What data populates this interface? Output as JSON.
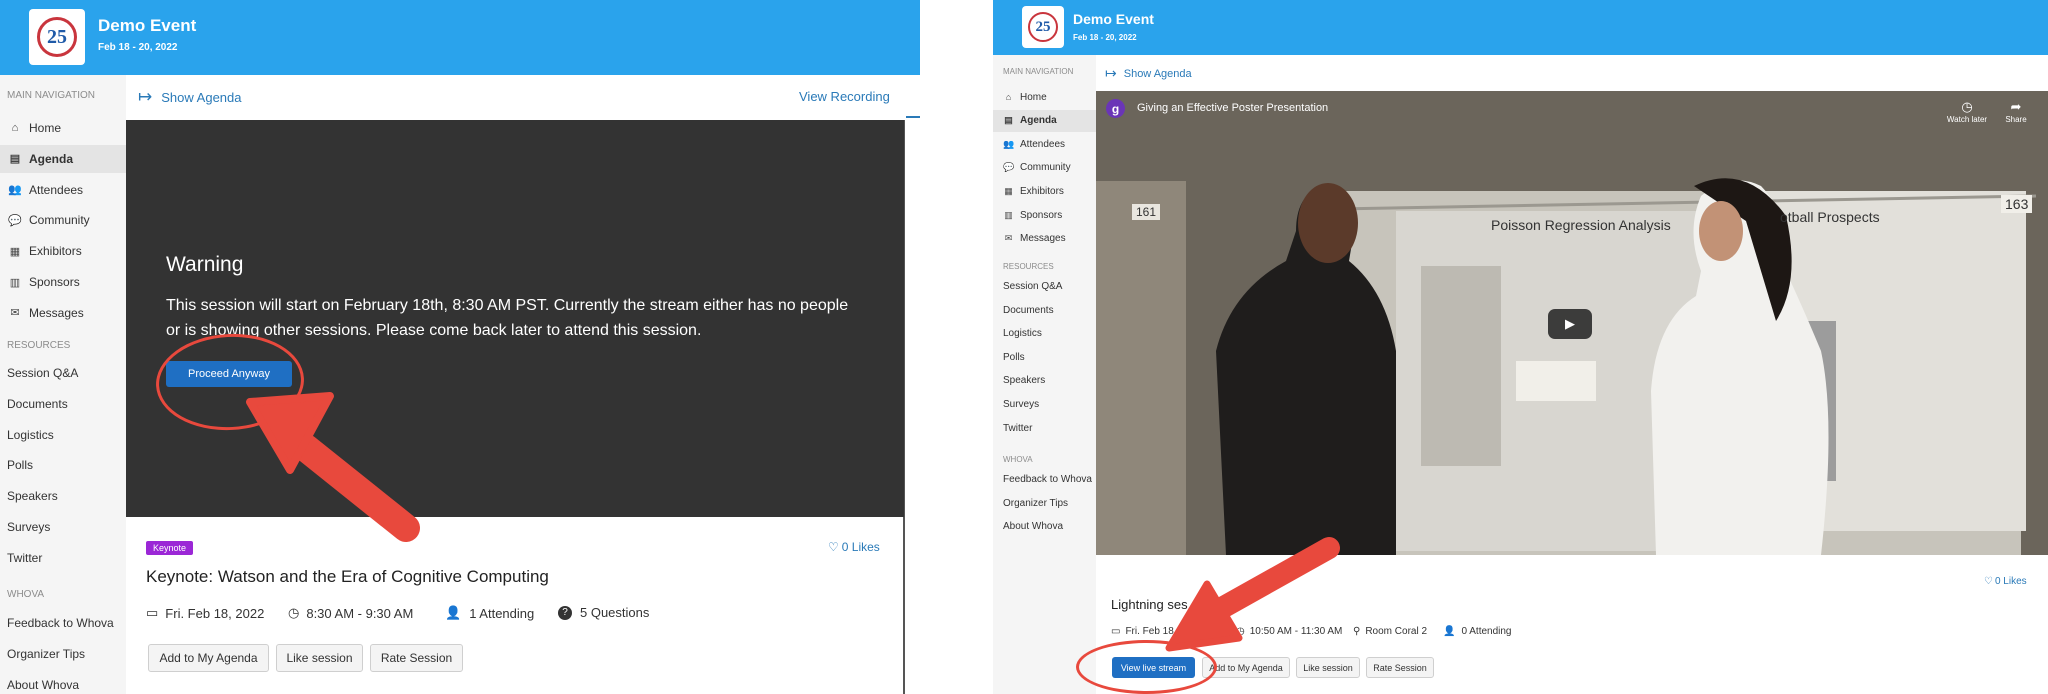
{
  "left": {
    "event_title": "Demo Event",
    "event_date": "Feb 18 - 20, 2022",
    "main_nav_label": "MAIN NAVIGATION",
    "nav": [
      {
        "label": "Home",
        "icon": "home-icon",
        "glyph": "⌂"
      },
      {
        "label": "Agenda",
        "icon": "calendar-icon",
        "glyph": "▤",
        "active": true
      },
      {
        "label": "Attendees",
        "icon": "users-icon",
        "glyph": "👥"
      },
      {
        "label": "Community",
        "icon": "chat-icon",
        "glyph": "💬"
      },
      {
        "label": "Exhibitors",
        "icon": "building-icon",
        "glyph": "▦"
      },
      {
        "label": "Sponsors",
        "icon": "sponsor-icon",
        "glyph": "▥"
      },
      {
        "label": "Messages",
        "icon": "envelope-icon",
        "glyph": "✉"
      }
    ],
    "resources_label": "RESOURCES",
    "resources": [
      "Session Q&A",
      "Documents",
      "Logistics",
      "Polls",
      "Speakers",
      "Surveys",
      "Twitter"
    ],
    "whova_label": "WHOVA",
    "whova": [
      "Feedback to Whova",
      "Organizer Tips",
      "About Whova"
    ],
    "show_agenda": "Show Agenda",
    "view_recording": "View Recording",
    "warning_title": "Warning",
    "warning_text": "This session will start on February 18th, 8:30 AM PST. Currently the stream either has no people or is showing other sessions. Please come back later to attend this session.",
    "proceed_button": "Proceed Anyway",
    "badge": "Keynote",
    "likes": "0 Likes",
    "session_title": "Keynote: Watson and the Era of Cognitive Computing",
    "date": "Fri. Feb 18, 2022",
    "time": "8:30 AM - 9:30 AM",
    "attending": "1 Attending",
    "questions": "5 Questions",
    "buttons": [
      "Add to My Agenda",
      "Like session",
      "Rate Session"
    ]
  },
  "right": {
    "event_title": "Demo Event",
    "event_date": "Feb 18 - 20, 2022",
    "main_nav_label": "MAIN NAVIGATION",
    "nav": [
      {
        "label": "Home",
        "icon": "home-icon",
        "glyph": "⌂"
      },
      {
        "label": "Agenda",
        "icon": "calendar-icon",
        "glyph": "▤",
        "active": true
      },
      {
        "label": "Attendees",
        "icon": "users-icon",
        "glyph": "👥"
      },
      {
        "label": "Community",
        "icon": "chat-icon",
        "glyph": "💬"
      },
      {
        "label": "Exhibitors",
        "icon": "building-icon",
        "glyph": "▦"
      },
      {
        "label": "Sponsors",
        "icon": "sponsor-icon",
        "glyph": "▥"
      },
      {
        "label": "Messages",
        "icon": "envelope-icon",
        "glyph": "✉"
      }
    ],
    "resources_label": "RESOURCES",
    "resources": [
      "Session Q&A",
      "Documents",
      "Logistics",
      "Polls",
      "Speakers",
      "Surveys",
      "Twitter"
    ],
    "whova_label": "WHOVA",
    "whova": [
      "Feedback to Whova",
      "Organizer Tips",
      "About Whova"
    ],
    "show_agenda": "Show Agenda",
    "video_channel_letter": "g",
    "video_title": "Giving an Effective Poster Presentation",
    "watch_later": "Watch later",
    "share": "Share",
    "poster_title": "Poisson Regression Analysis",
    "poster_title_right": "otball Prospects",
    "poster_number_left": "161",
    "poster_number_right": "163",
    "likes": "0 Likes",
    "session_title": "Lightning ses",
    "date": "Fri. Feb 18",
    "time": "10:50 AM - 11:30 AM",
    "room": "Room Coral 2",
    "attending": "0 Attending",
    "view_live": "View live stream",
    "buttons": [
      "Add to My Agenda",
      "Like session",
      "Rate Session"
    ]
  }
}
